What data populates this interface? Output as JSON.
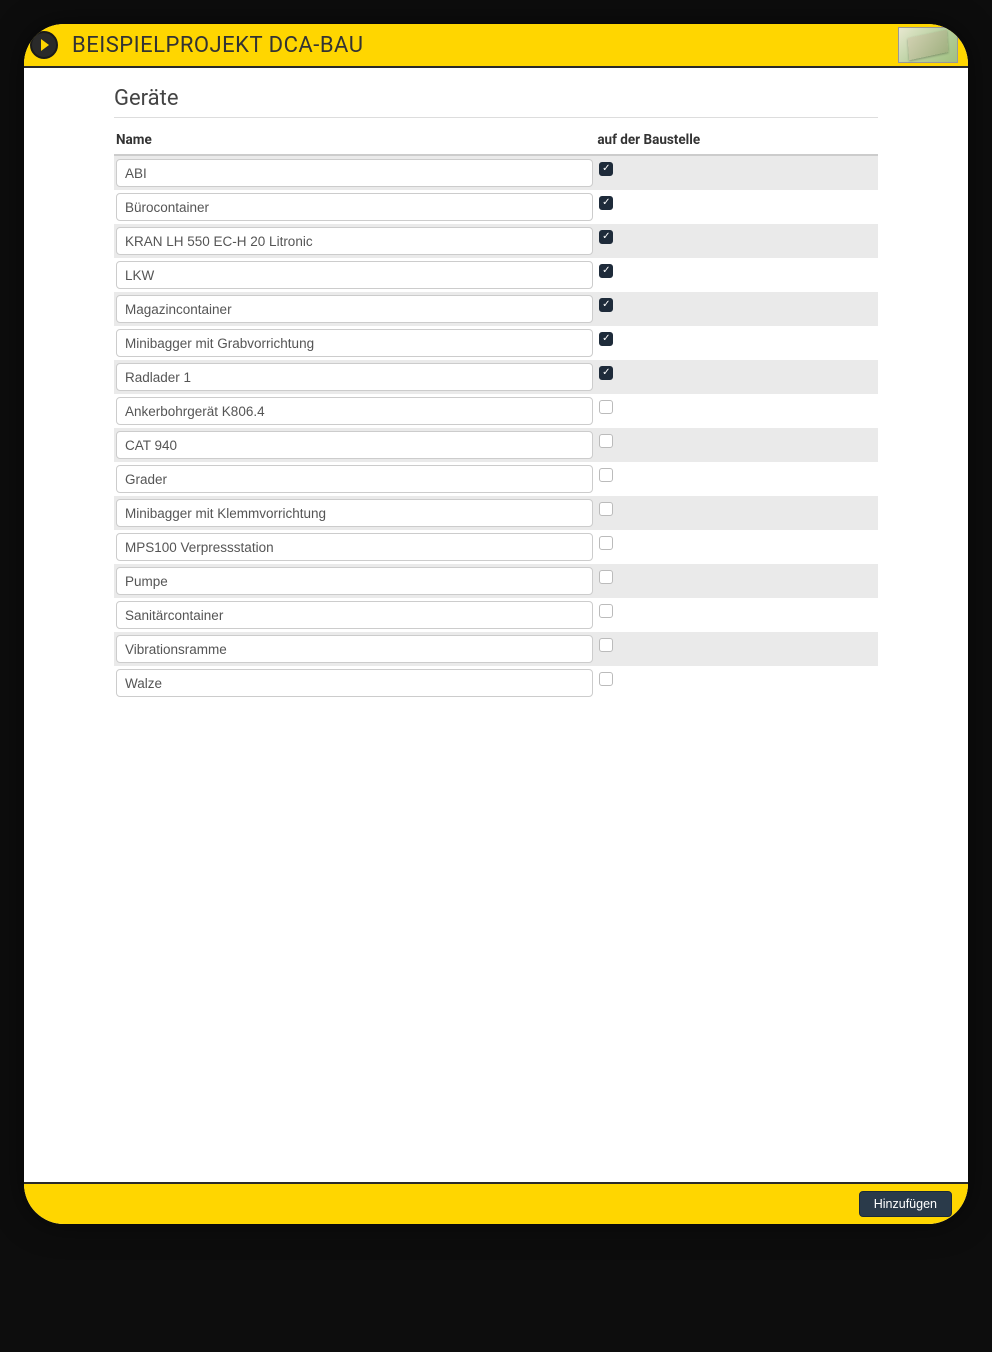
{
  "header": {
    "title": "BEISPIELPROJEKT DCA-BAU"
  },
  "page": {
    "title": "Geräte"
  },
  "table": {
    "headers": {
      "name": "Name",
      "onsite": "auf der Baustelle"
    },
    "rows": [
      {
        "name": "ABI",
        "checked": true
      },
      {
        "name": "Bürocontainer",
        "checked": true
      },
      {
        "name": "KRAN LH 550 EC-H 20 Litronic",
        "checked": true
      },
      {
        "name": "LKW",
        "checked": true
      },
      {
        "name": "Magazincontainer",
        "checked": true
      },
      {
        "name": "Minibagger mit Grabvorrichtung",
        "checked": true
      },
      {
        "name": "Radlader 1",
        "checked": true
      },
      {
        "name": "Ankerbohrgerät K806.4",
        "checked": false
      },
      {
        "name": "CAT 940",
        "checked": false
      },
      {
        "name": "Grader",
        "checked": false
      },
      {
        "name": "Minibagger mit Klemmvorrichtung",
        "checked": false
      },
      {
        "name": "MPS100 Verpressstation",
        "checked": false
      },
      {
        "name": "Pumpe",
        "checked": false
      },
      {
        "name": "Sanitärcontainer",
        "checked": false
      },
      {
        "name": "Vibrationsramme",
        "checked": false
      },
      {
        "name": "Walze",
        "checked": false
      }
    ]
  },
  "footer": {
    "add_label": "Hinzufügen"
  }
}
